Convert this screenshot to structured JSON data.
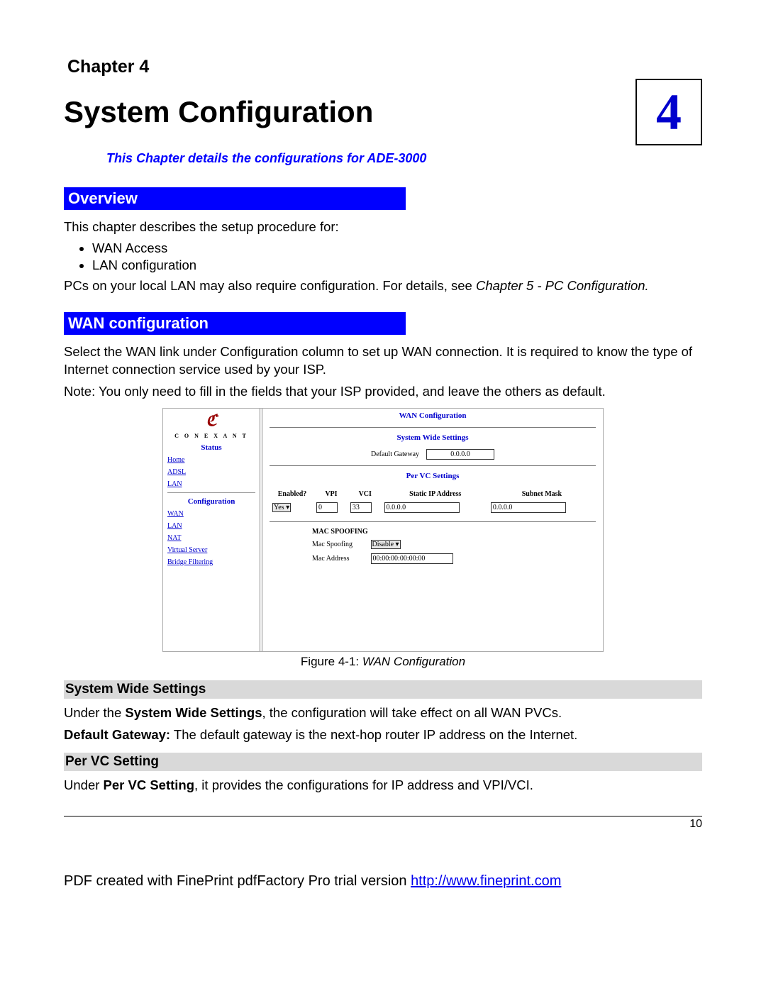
{
  "chapter_label": "Chapter 4",
  "title": "System Configuration",
  "chapter_number": "4",
  "subtitle": "This Chapter details the configurations for ADE-3000",
  "sections": {
    "overview": {
      "heading": "Overview",
      "intro": "This chapter describes the setup procedure for:",
      "bullets": [
        "WAN Access",
        "LAN configuration"
      ],
      "after_pre": "PCs on your local LAN may also require configuration. For details, see ",
      "after_em": "Chapter 5 - PC Configuration."
    },
    "wan": {
      "heading": "WAN configuration",
      "p1": "Select the WAN link under Configuration column to set up WAN connection. It is required to know the type of Internet connection service used by your ISP.",
      "p2": "Note: You only need to fill in the fields that your ISP provided, and leave the others as default."
    },
    "figure_caption_pre": "Figure 4-1: ",
    "figure_caption_em": "WAN Configuration",
    "sws": {
      "heading": "System Wide Settings",
      "p_pre": "Under the ",
      "p_strong": "System Wide Settings",
      "p_post": ", the configuration will take effect on all WAN PVCs.",
      "dg_strong": "Default Gateway:",
      "dg_post": " The default gateway is the next-hop router IP address on the Internet."
    },
    "pvc": {
      "heading": "Per VC Setting",
      "p_pre": "Under ",
      "p_strong": "Per VC Setting",
      "p_post": ", it provides the configurations for IP address and VPI/VCI."
    }
  },
  "screenshot": {
    "brand": "C O N E X A N T",
    "status_label": "Status",
    "status_links": [
      "Home",
      "ADSL",
      "LAN"
    ],
    "config_label": "Configuration",
    "config_links": [
      "WAN",
      "LAN",
      "NAT",
      "Virtual Server",
      "Bridge Filtering"
    ],
    "main_title": "WAN Configuration",
    "sws_title": "System Wide Settings",
    "default_gateway_label": "Default Gateway",
    "default_gateway_value": "0.0.0.0",
    "pvc_title": "Per VC Settings",
    "table_headers": [
      "Enabled?",
      "VPI",
      "VCI",
      "Static IP Address",
      "Subnet Mask"
    ],
    "row": {
      "enabled": "Yes",
      "vpi": "0",
      "vci": "33",
      "ip": "0.0.0.0",
      "mask": "0.0.0.0"
    },
    "mac_spoofing_heading": "MAC SPOOFING",
    "mac_spoofing_label": "Mac Spoofing",
    "mac_spoofing_value": "Disable",
    "mac_address_label": "Mac Address",
    "mac_address_value": "00:00:00:00:00:00"
  },
  "page_number": "10",
  "footer_pre": "PDF created with FinePrint pdfFactory Pro trial version ",
  "footer_link": "http://www.fineprint.com"
}
